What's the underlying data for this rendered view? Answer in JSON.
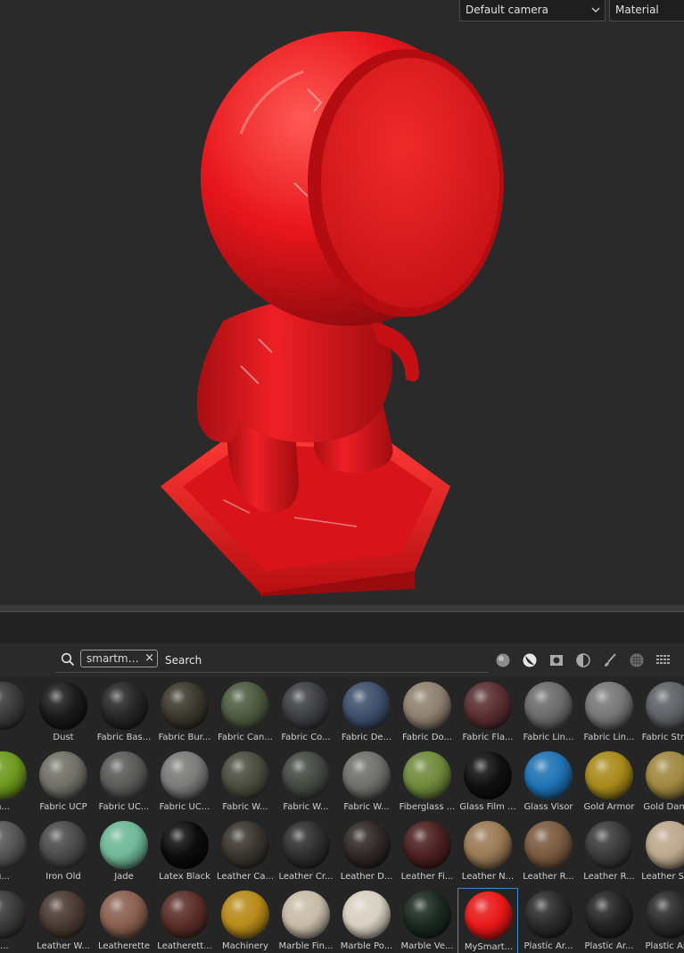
{
  "viewport": {
    "camera_dropdown": "Default camera",
    "mode_dropdown": "Material"
  },
  "shelf": {
    "search_chip": "smartmat··",
    "chip_close": "×",
    "search_label": "Search",
    "filter_icons": [
      "material-filter-icon",
      "smart-material-filter-icon",
      "mask-filter-icon",
      "filter-generator-icon",
      "brush-icon",
      "texture-icon",
      "grid-view-icon"
    ],
    "rows": [
      [
        {
          "name": "",
          "color": "#3a3a3a"
        },
        {
          "name": "Dust",
          "color": "#1a1a1a"
        },
        {
          "name": "Fabric Bas...",
          "color": "#262626"
        },
        {
          "name": "Fabric Bur...",
          "color": "#3b372c"
        },
        {
          "name": "Fabric Can...",
          "color": "#4d5a3f"
        },
        {
          "name": "Fabric Co...",
          "color": "#3c3e41"
        },
        {
          "name": "Fabric De...",
          "color": "#3d4f6a"
        },
        {
          "name": "Fabric Do...",
          "color": "#8f8170"
        },
        {
          "name": "Fabric Fla...",
          "color": "#5a2e31"
        },
        {
          "name": "Fabric Lin...",
          "color": "#6b6b6b"
        },
        {
          "name": "Fabric Lin...",
          "color": "#777777"
        },
        {
          "name": "Fabric Stre...",
          "color": "#5d6065"
        }
      ],
      [
        {
          "name": "n...",
          "color": "#6e9a1f"
        },
        {
          "name": "Fabric UCP",
          "color": "#707066"
        },
        {
          "name": "Fabric UC...",
          "color": "#5a5a58"
        },
        {
          "name": "Fabric UC...",
          "color": "#7a7a78"
        },
        {
          "name": "Fabric W...",
          "color": "#4a4c3e"
        },
        {
          "name": "Fabric W...",
          "color": "#434840"
        },
        {
          "name": "Fabric W...",
          "color": "#6f6f6b"
        },
        {
          "name": "Fiberglass ...",
          "color": "#6f8a3c"
        },
        {
          "name": "Glass Film ...",
          "color": "#101010"
        },
        {
          "name": "Glass Visor",
          "color": "#1f73b4"
        },
        {
          "name": "Gold Armor",
          "color": "#a88a1a"
        },
        {
          "name": "Gold Dam...",
          "color": "#a08840"
        }
      ],
      [
        {
          "name": "g...",
          "color": "#555555"
        },
        {
          "name": "Iron Old",
          "color": "#4a4a4a"
        },
        {
          "name": "Jade",
          "color": "#6fb898"
        },
        {
          "name": "Latex Black",
          "color": "#0c0c0c"
        },
        {
          "name": "Leather Ca...",
          "color": "#3a342e"
        },
        {
          "name": "Leather Cr...",
          "color": "#2e2e2e"
        },
        {
          "name": "Leather D...",
          "color": "#2f2825"
        },
        {
          "name": "Leather Fi...",
          "color": "#4c2020"
        },
        {
          "name": "Leather N...",
          "color": "#9a7a55"
        },
        {
          "name": "Leather R...",
          "color": "#7a5a40"
        },
        {
          "name": "Leather R...",
          "color": "#3a3a3a"
        },
        {
          "name": "Leather Se...",
          "color": "#bca88c"
        }
      ],
      [
        {
          "name": "t...",
          "color": "#3a3a3a"
        },
        {
          "name": "Leather W...",
          "color": "#4a3a32"
        },
        {
          "name": "Leatherette",
          "color": "#8a6050"
        },
        {
          "name": "Leatherett...",
          "color": "#5a2e28"
        },
        {
          "name": "Machinery",
          "color": "#b88a1a"
        },
        {
          "name": "Marble Fin...",
          "color": "#c8bca8"
        },
        {
          "name": "Marble Po...",
          "color": "#d8d0c0"
        },
        {
          "name": "Marble Ve...",
          "color": "#1a2a20"
        },
        {
          "name": "MySmart...",
          "color": "#e81818"
        },
        {
          "name": "Plastic Ar...",
          "color": "#2a2a2a"
        },
        {
          "name": "Plastic Ar...",
          "color": "#242424"
        },
        {
          "name": "Plastic Ar...",
          "color": "#2a2a2a"
        }
      ]
    ],
    "selected_tile": "MySmart..."
  },
  "colors": {
    "model_red": "#e8161c",
    "selection_blue": "#3d8bd8"
  }
}
